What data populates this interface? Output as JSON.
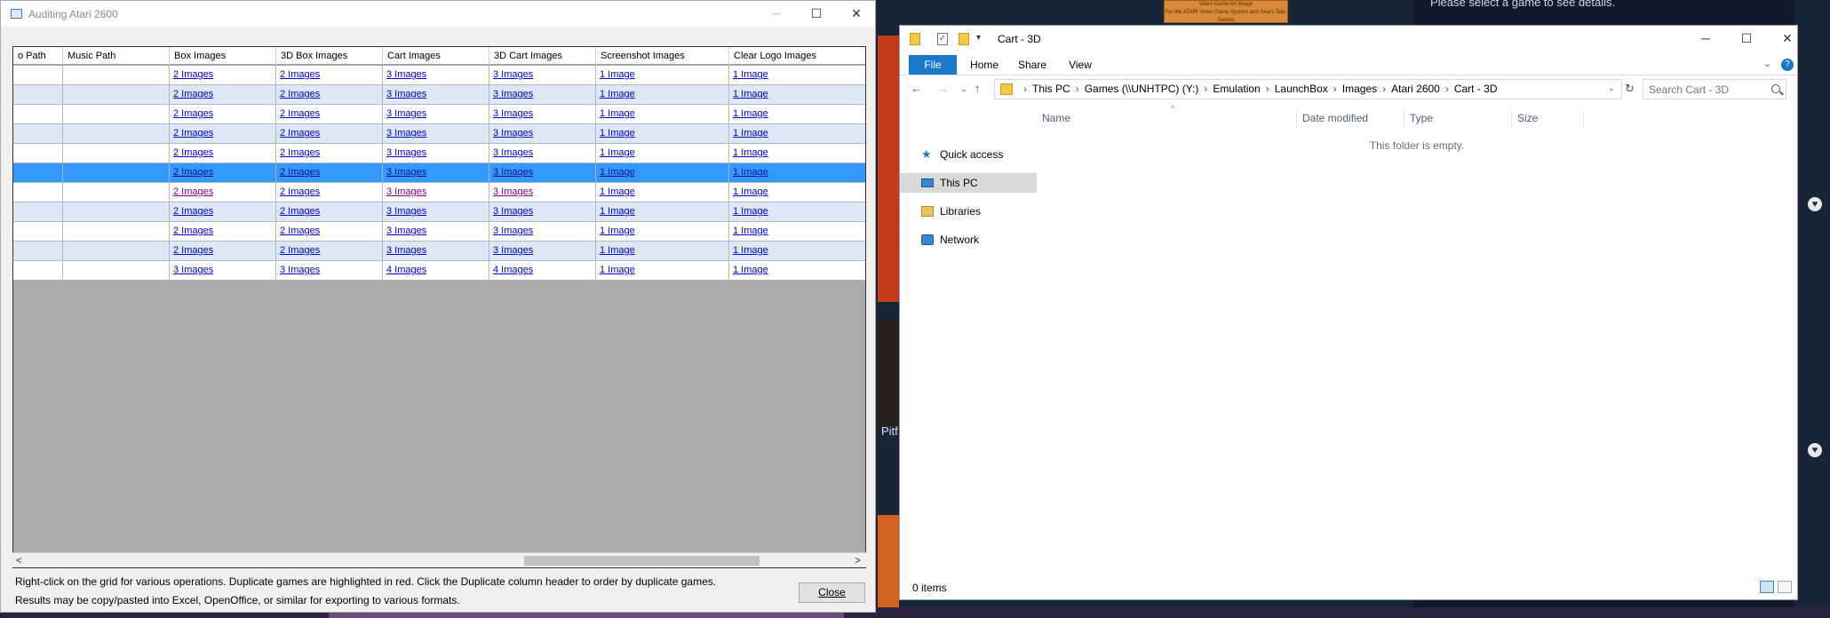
{
  "background": {
    "thumb_lines": [
      "Video Game Art Image",
      "For the ATARI Video Game System and Sears Tele-Games"
    ],
    "hint": "Please select a game to see details.",
    "partial_title": "Pitf"
  },
  "audit": {
    "title": "Auditing Atari 2600",
    "minimize_icon": "─",
    "maximize_icon": "☐",
    "close_icon": "✕",
    "columns": [
      "o Path",
      "Music Path",
      "Box Images",
      "3D Box Images",
      "Cart Images",
      "3D Cart Images",
      "Screenshot Images",
      "Clear Logo Images"
    ],
    "rows": [
      {
        "box": "2 Images",
        "box3d": "2 Images",
        "cart": "3 Images",
        "cart3d": "3 Images",
        "screenshot": "1 Image",
        "logo": "1 Image"
      },
      {
        "box": "2 Images",
        "box3d": "2 Images",
        "cart": "3 Images",
        "cart3d": "3 Images",
        "screenshot": "1 Image",
        "logo": "1 Image"
      },
      {
        "box": "2 Images",
        "box3d": "2 Images",
        "cart": "3 Images",
        "cart3d": "3 Images",
        "screenshot": "1 Image",
        "logo": "1 Image"
      },
      {
        "box": "2 Images",
        "box3d": "2 Images",
        "cart": "3 Images",
        "cart3d": "3 Images",
        "screenshot": "1 Image",
        "logo": "1 Image"
      },
      {
        "box": "2 Images",
        "box3d": "2 Images",
        "cart": "3 Images",
        "cart3d": "3 Images",
        "screenshot": "1 Image",
        "logo": "1 Image"
      },
      {
        "box": "2 Images",
        "box3d": "2 Images",
        "cart": "3 Images",
        "cart3d": "3 Images",
        "screenshot": "1 Image",
        "logo": "1 Image"
      },
      {
        "box": "2 Images",
        "box3d": "2 Images",
        "cart": "3 Images",
        "cart3d": "3 Images",
        "screenshot": "1 Image",
        "logo": "1 Image"
      },
      {
        "box": "2 Images",
        "box3d": "2 Images",
        "cart": "3 Images",
        "cart3d": "3 Images",
        "screenshot": "1 Image",
        "logo": "1 Image"
      },
      {
        "box": "2 Images",
        "box3d": "2 Images",
        "cart": "3 Images",
        "cart3d": "3 Images",
        "screenshot": "1 Image",
        "logo": "1 Image"
      },
      {
        "box": "2 Images",
        "box3d": "2 Images",
        "cart": "3 Images",
        "cart3d": "3 Images",
        "screenshot": "1 Image",
        "logo": "1 Image"
      },
      {
        "box": "3 Images",
        "box3d": "3 Images",
        "cart": "4 Images",
        "cart3d": "4 Images",
        "screenshot": "1 Image",
        "logo": "1 Image"
      }
    ],
    "selected_row": 5,
    "visited_row": 6,
    "scroll_left_icon": "<",
    "scroll_right_icon": ">",
    "status_line1": "Right-click on the grid for various operations. Duplicate games are highlighted in red. Click the Duplicate column header to order by duplicate games.",
    "status_line2": "Results may be copy/pasted into Excel, OpenOffice, or similar for exporting to various formats.",
    "close_button": "Close",
    "colors": {
      "selected_row": "#3399ff",
      "alt_row": "#dce8f5",
      "link": "#0000d4",
      "visited_link": "#800080"
    }
  },
  "explorer": {
    "title": "Cart - 3D",
    "qa_check_glyph": "✓",
    "qa_down_glyph": "▾",
    "minimize_icon": "─",
    "maximize_icon": "☐",
    "close_icon": "✕",
    "tabs": {
      "file": "File",
      "home": "Home",
      "share": "Share",
      "view": "View"
    },
    "ribbon_expand_icon": "⌄",
    "help_icon": "?",
    "nav": {
      "back": "←",
      "forward": "→",
      "recent": "⌄",
      "up": "↑",
      "refresh": "↻",
      "address_dropdown": "⌄"
    },
    "path": [
      "This PC",
      "Games (\\\\UNHTPC) (Y:)",
      "Emulation",
      "LaunchBox",
      "Images",
      "Atari 2600",
      "Cart - 3D"
    ],
    "path_separator": "›",
    "search_placeholder": "Search Cart - 3D",
    "nav_pane": {
      "quick_access": "Quick access",
      "quick_access_glyph": "★",
      "this_pc": "This PC",
      "libraries": "Libraries",
      "network": "Network"
    },
    "columns": {
      "name": "Name",
      "date": "Date modified",
      "type": "Type",
      "size": "Size"
    },
    "sort_glyph": "^",
    "empty_message": "This folder is empty.",
    "item_count": "0 items"
  }
}
